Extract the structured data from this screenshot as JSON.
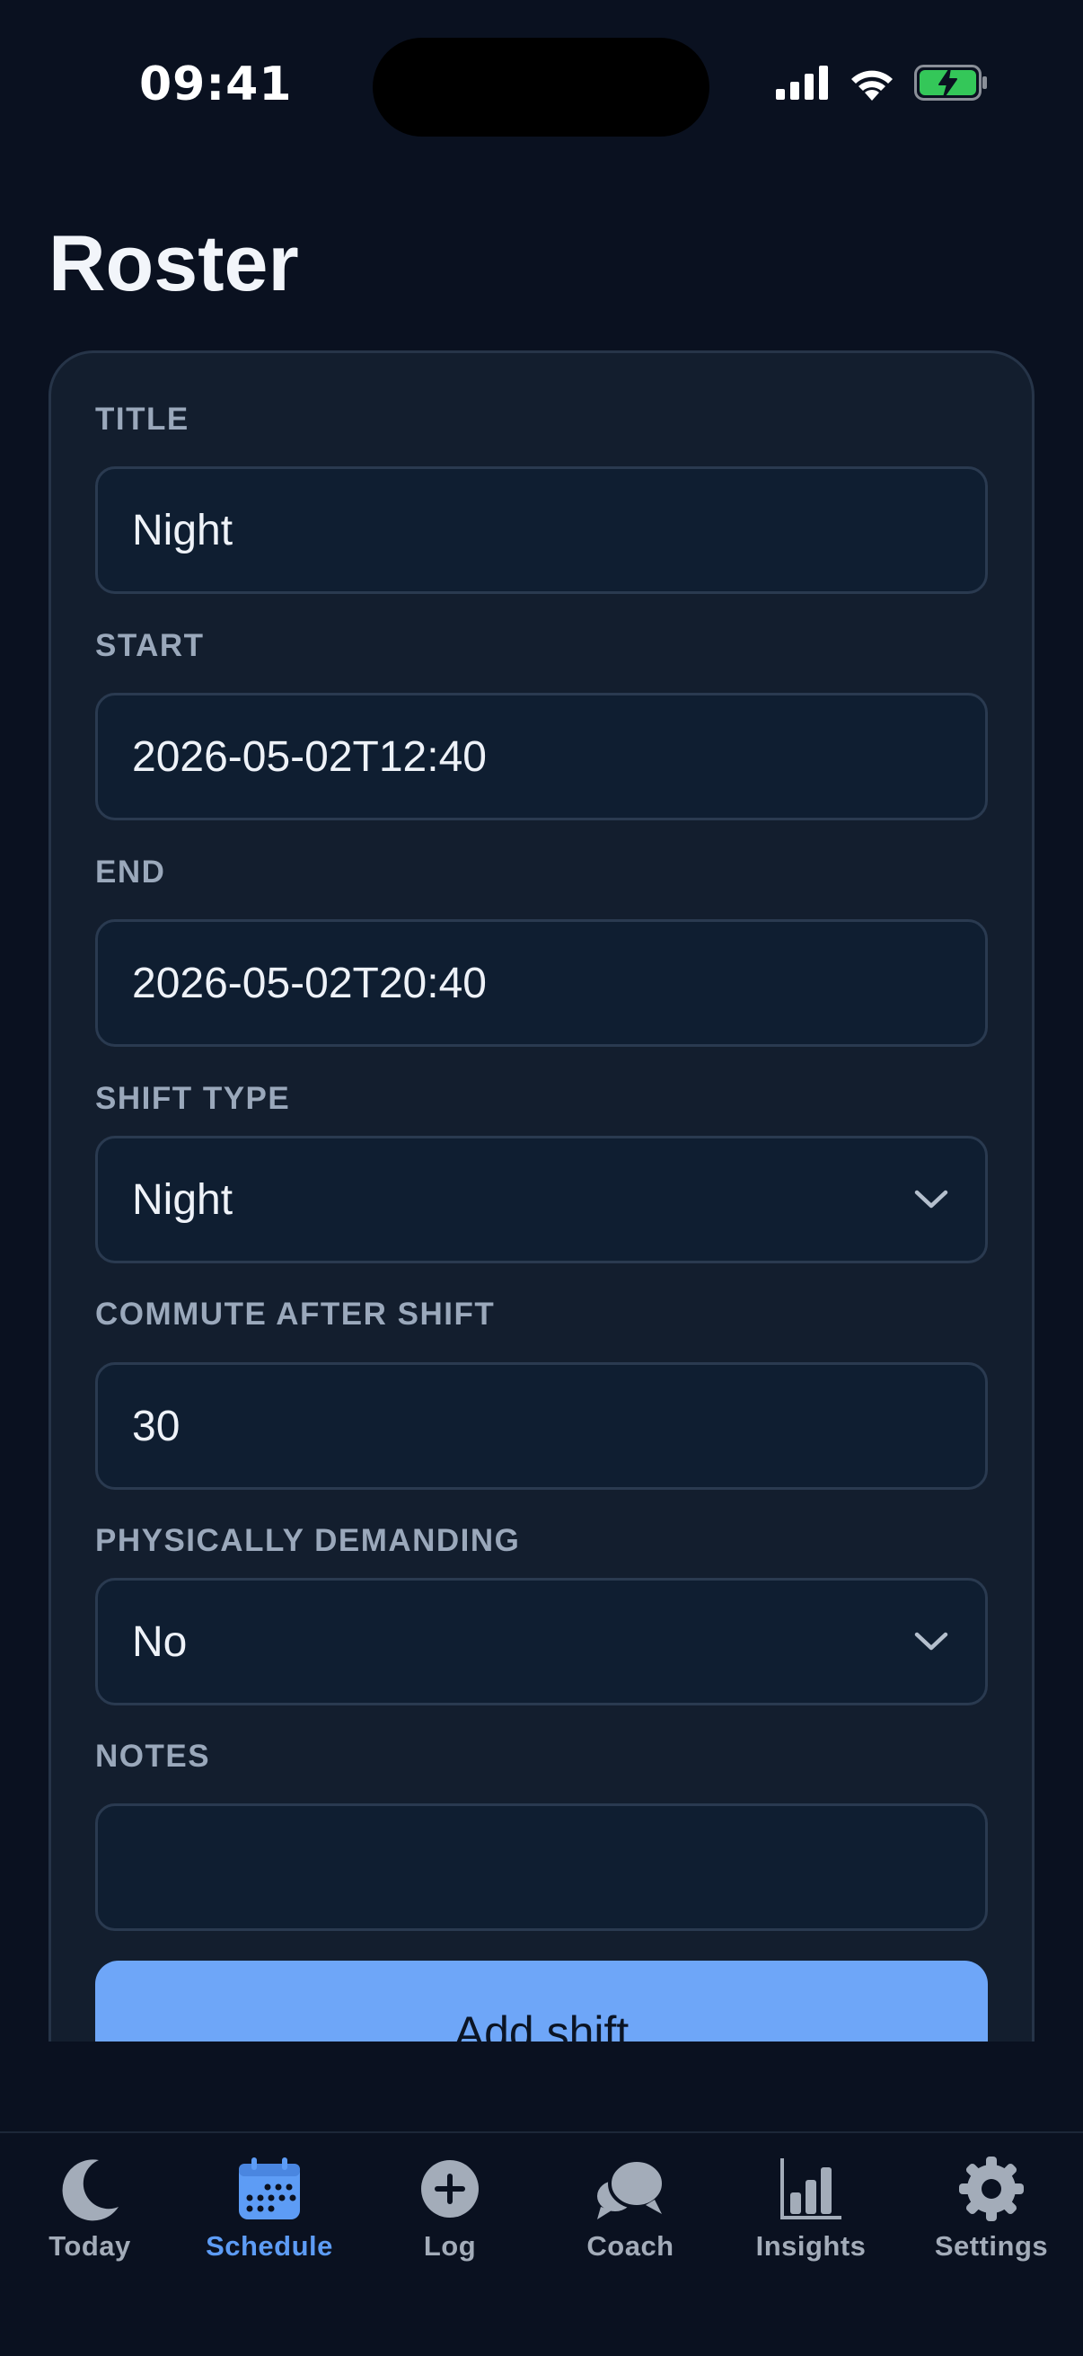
{
  "status_bar": {
    "time": "09:41",
    "icons": [
      "cellular-signal-icon",
      "wifi-icon",
      "battery-charging-icon"
    ]
  },
  "page": {
    "title": "Roster"
  },
  "form": {
    "title": {
      "label": "TITLE",
      "value": "Night"
    },
    "start": {
      "label": "START",
      "value": "2026-05-02T12:40"
    },
    "end": {
      "label": "END",
      "value": "2026-05-02T20:40"
    },
    "shift_type": {
      "label": "SHIFT TYPE",
      "value": "Night"
    },
    "commute": {
      "label": "COMMUTE AFTER SHIFT",
      "value": "30"
    },
    "physically_demanding": {
      "label": "PHYSICALLY DEMANDING",
      "value": "No"
    },
    "notes": {
      "label": "NOTES",
      "value": ""
    },
    "submit_label": "Add shift"
  },
  "tabs": [
    {
      "label": "Today",
      "icon": "moon-icon",
      "active": false
    },
    {
      "label": "Schedule",
      "icon": "calendar-icon",
      "active": true
    },
    {
      "label": "Log",
      "icon": "plus-circle-icon",
      "active": false
    },
    {
      "label": "Coach",
      "icon": "chat-bubbles-icon",
      "active": false
    },
    {
      "label": "Insights",
      "icon": "bar-chart-icon",
      "active": false
    },
    {
      "label": "Settings",
      "icon": "gear-icon",
      "active": false
    }
  ],
  "colors": {
    "background": "#0a1120",
    "card": "#131e2e",
    "field": "#0f1e31",
    "accent": "#6ea6f8",
    "tab_active": "#5d9cf5",
    "tab_inactive": "#a3acb9",
    "battery_green": "#34c759"
  }
}
